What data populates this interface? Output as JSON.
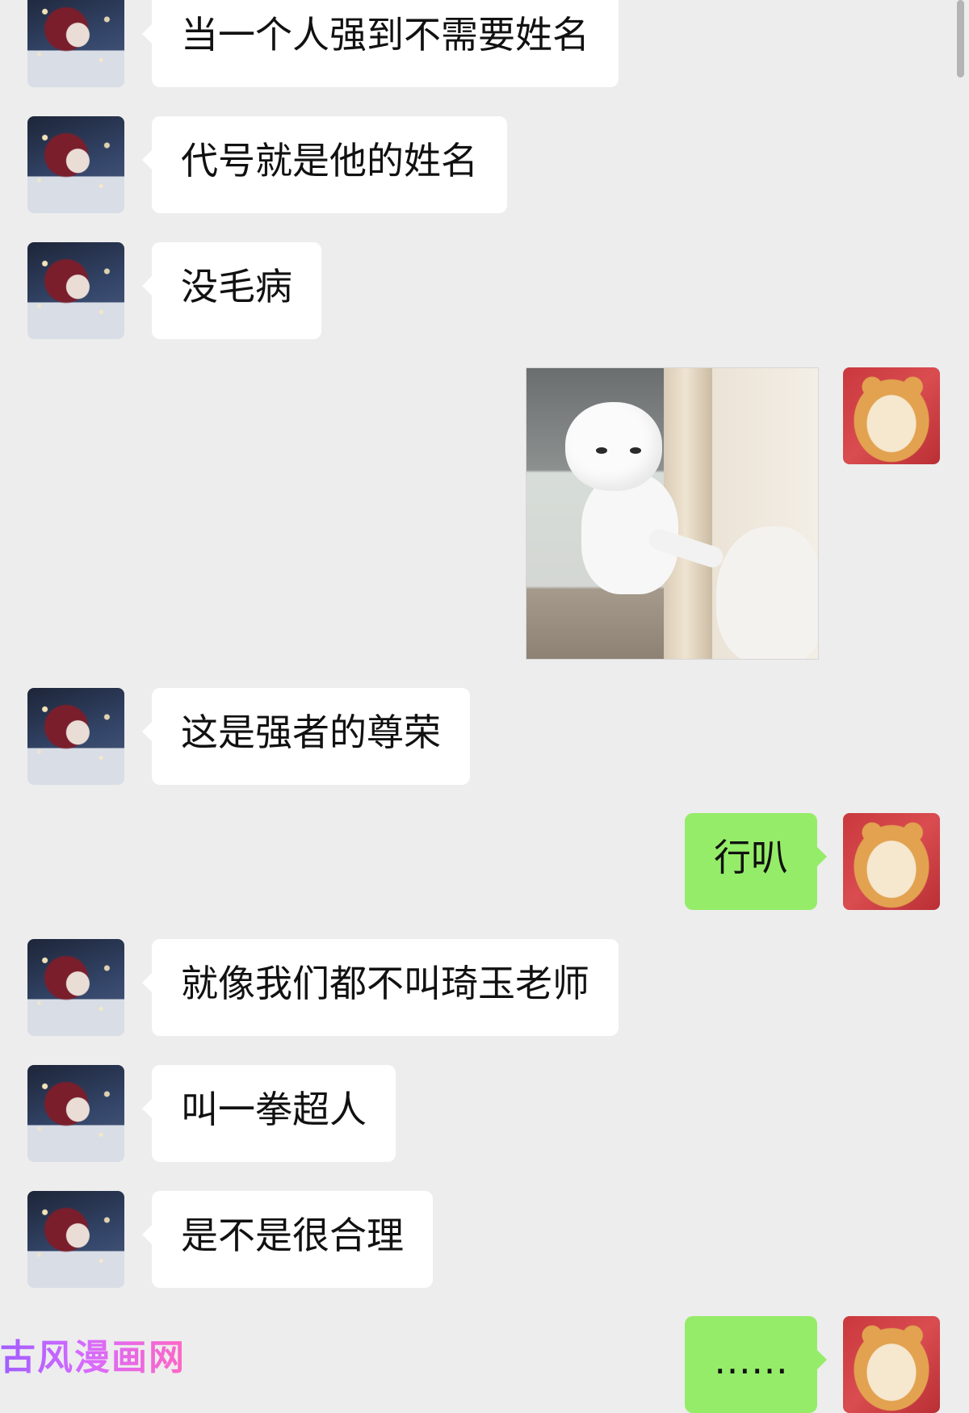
{
  "chat": {
    "messages": [
      {
        "side": "left",
        "type": "text",
        "text": "当一个人强到不需要姓名"
      },
      {
        "side": "left",
        "type": "text",
        "text": "代号就是他的姓名"
      },
      {
        "side": "left",
        "type": "text",
        "text": "没毛病"
      },
      {
        "side": "right",
        "type": "sticker",
        "sticker": "cat-pushing-cat-at-door"
      },
      {
        "side": "left",
        "type": "text",
        "text": "这是强者的尊荣"
      },
      {
        "side": "right",
        "type": "text",
        "text": "行叭"
      },
      {
        "side": "left",
        "type": "text",
        "text": "就像我们都不叫琦玉老师"
      },
      {
        "side": "left",
        "type": "text",
        "text": "叫一拳超人"
      },
      {
        "side": "left",
        "type": "text",
        "text": "是不是很合理"
      },
      {
        "side": "right",
        "type": "text",
        "text": "……"
      }
    ]
  },
  "watermark": {
    "text": "古风漫画网"
  },
  "colors": {
    "background": "#ededed",
    "received_bubble": "#ffffff",
    "sent_bubble": "#95ec69"
  },
  "avatars": {
    "left": "long-haired-character-avatar",
    "right": "shiba-inu-avatar"
  }
}
